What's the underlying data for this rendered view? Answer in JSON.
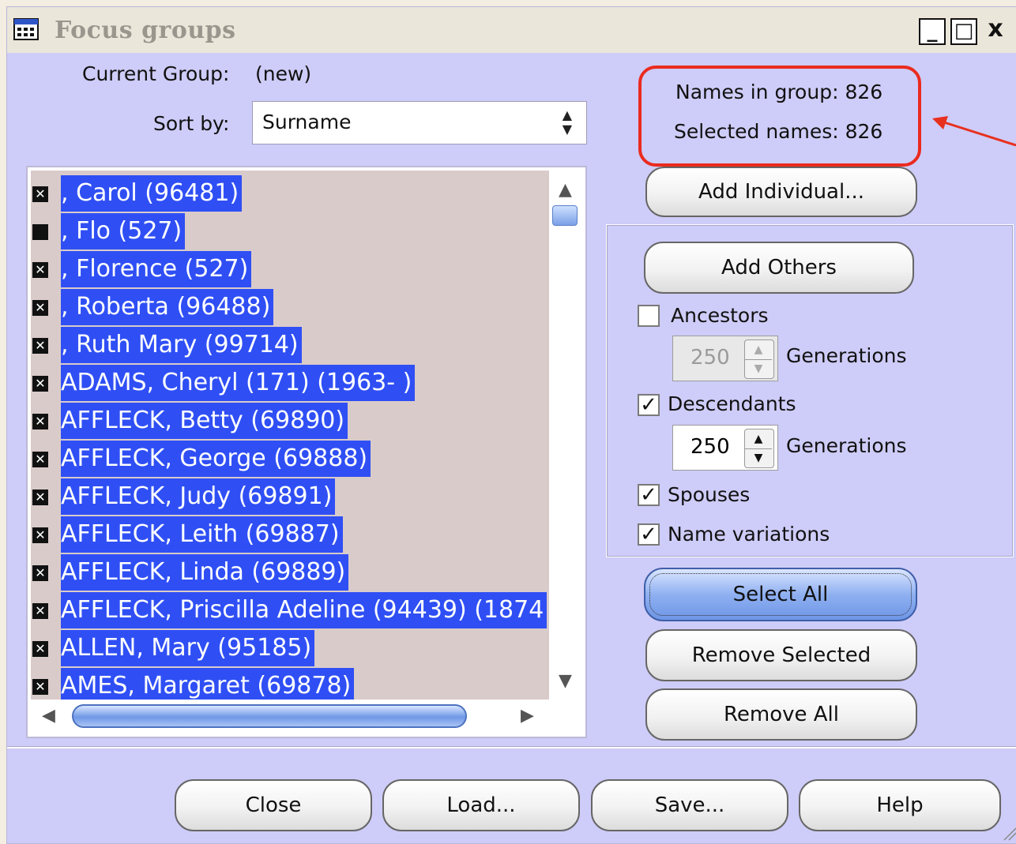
{
  "window": {
    "title": "Focus groups",
    "controls": {
      "minimize": "_",
      "maximize": "□",
      "close": "x"
    }
  },
  "current_group": {
    "label": "Current Group:",
    "value": "(new)"
  },
  "sort": {
    "label": "Sort by:",
    "value": "Surname"
  },
  "counts": {
    "names_in_group": "Names in group: 826",
    "selected_names": "Selected names: 826"
  },
  "list": {
    "items": [
      {
        "mark": "X",
        "text": ", Carol (96481)"
      },
      {
        "mark": "",
        "text": ", Flo (527)"
      },
      {
        "mark": "X",
        "text": ", Florence (527)"
      },
      {
        "mark": "X",
        "text": ", Roberta (96488)"
      },
      {
        "mark": "X",
        "text": ", Ruth Mary (99714)"
      },
      {
        "mark": "X",
        "text": "ADAMS, Cheryl (171) (1963-   )"
      },
      {
        "mark": "X",
        "text": "AFFLECK, Betty (69890)"
      },
      {
        "mark": "X",
        "text": "AFFLECK, George (69888)"
      },
      {
        "mark": "X",
        "text": "AFFLECK, Judy (69891)"
      },
      {
        "mark": "X",
        "text": "AFFLECK, Leith (69887)"
      },
      {
        "mark": "X",
        "text": "AFFLECK, Linda (69889)"
      },
      {
        "mark": "X",
        "text": "AFFLECK, Priscilla Adeline (94439) (1874"
      },
      {
        "mark": "X",
        "text": "ALLEN, Mary (95185)"
      },
      {
        "mark": "X",
        "text": "AMES, Margaret (69878)"
      }
    ]
  },
  "buttons": {
    "add_individual": "Add Individual...",
    "add_others": "Add Others",
    "select_all": "Select All",
    "remove_selected": "Remove Selected",
    "remove_all": "Remove All",
    "close": "Close",
    "load": "Load...",
    "save": "Save...",
    "help": "Help"
  },
  "options": {
    "ancestors": {
      "label": "Ancestors",
      "checked": false,
      "generations": "250",
      "enabled": false
    },
    "descendants": {
      "label": "Descendants",
      "checked": true,
      "generations": "250",
      "enabled": true
    },
    "generations_label": "Generations",
    "spouses": {
      "label": "Spouses",
      "checked": true
    },
    "name_variations": {
      "label": "Name variations",
      "checked": true
    }
  },
  "colors": {
    "window_bg": "#ceccf8",
    "selection": "#2f4ff5",
    "highlight_box": "#ea2b1f",
    "arrow": "#e8301f"
  }
}
